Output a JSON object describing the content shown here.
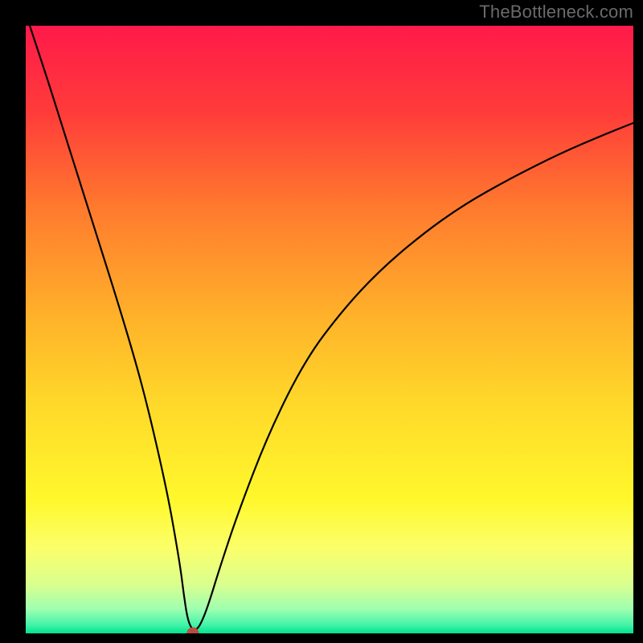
{
  "watermark": "TheBottleneck.com",
  "chart_data": {
    "type": "line",
    "title": "",
    "xlabel": "",
    "ylabel": "",
    "xlim": [
      0,
      100
    ],
    "ylim": [
      0,
      100
    ],
    "grid": false,
    "legend": false,
    "gradient_stops": [
      {
        "offset": 0.0,
        "color": "#ff1a4a"
      },
      {
        "offset": 0.14,
        "color": "#ff3b3a"
      },
      {
        "offset": 0.3,
        "color": "#ff7a2e"
      },
      {
        "offset": 0.48,
        "color": "#ffb22a"
      },
      {
        "offset": 0.62,
        "color": "#ffd82a"
      },
      {
        "offset": 0.78,
        "color": "#fff82c"
      },
      {
        "offset": 0.86,
        "color": "#fbff6a"
      },
      {
        "offset": 0.92,
        "color": "#d9ff8f"
      },
      {
        "offset": 0.96,
        "color": "#9fffb0"
      },
      {
        "offset": 0.985,
        "color": "#47f4a9"
      },
      {
        "offset": 1.0,
        "color": "#00e58e"
      }
    ],
    "series": [
      {
        "name": "bottleneck-curve",
        "color": "#000000",
        "x": [
          0.0,
          3.0,
          6.0,
          9.0,
          12.0,
          15.0,
          18.0,
          20.0,
          22.0,
          23.5,
          24.5,
          25.5,
          26.0,
          26.6,
          27.3,
          28.0,
          28.8,
          30.0,
          32.0,
          35.0,
          40.0,
          46.0,
          52.0,
          58.0,
          65.0,
          72.0,
          80.0,
          88.0,
          95.0,
          100.0
        ],
        "y": [
          102.0,
          93.0,
          83.5,
          74.0,
          64.5,
          55.0,
          45.0,
          37.5,
          29.0,
          22.0,
          16.5,
          10.5,
          6.5,
          2.5,
          0.7,
          0.5,
          1.5,
          4.5,
          11.0,
          20.0,
          33.0,
          45.0,
          53.0,
          59.5,
          65.5,
          70.5,
          75.0,
          79.0,
          82.0,
          84.0
        ]
      }
    ],
    "marker": {
      "name": "optimum-point",
      "x": 27.5,
      "y": 0.0,
      "r_units": 1.0,
      "color": "#bb4d40"
    }
  }
}
